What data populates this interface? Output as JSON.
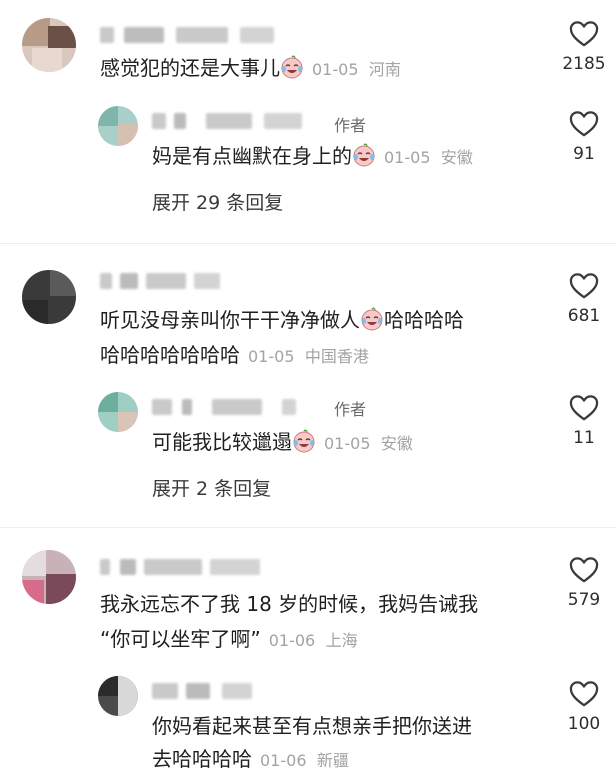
{
  "threads": [
    {
      "comment": {
        "text": "感觉犯的还是大事儿",
        "time": "01-05",
        "location": "河南",
        "likes": "2185"
      },
      "reply": {
        "author_tag": "作者",
        "text": "妈是有点幽默在身上的",
        "time": "01-05",
        "location": "安徽",
        "likes": "91"
      },
      "expand": {
        "prefix": "展开",
        "count": "29",
        "suffix": "条回复"
      }
    },
    {
      "comment": {
        "text_line1": "听见没母亲叫你干干净净做人",
        "text_line1_tail": "哈哈哈哈",
        "text_line2": "哈哈哈哈哈哈哈",
        "time": "01-05",
        "location": "中国香港",
        "likes": "681"
      },
      "reply": {
        "author_tag": "作者",
        "text": "可能我比较邋遢",
        "time": "01-05",
        "location": "安徽",
        "likes": "11"
      },
      "expand": {
        "prefix": "展开",
        "count": "2",
        "suffix": "条回复"
      }
    },
    {
      "comment": {
        "text_line1": "我永远忘不了我 18 岁的时候，我妈告诫我",
        "text_line2": "“你可以坐牢了啊”",
        "time": "01-06",
        "location": "上海",
        "likes": "579"
      },
      "reply": {
        "text_line1": "你妈看起来甚至有点想亲手把你送进",
        "text_line2": "去哈哈哈哈",
        "time": "01-06",
        "location": "新疆",
        "likes": "100"
      }
    }
  ],
  "icons": {
    "like": "heart-outline-icon",
    "emoji": "crying-laughing-emoji-icon"
  }
}
